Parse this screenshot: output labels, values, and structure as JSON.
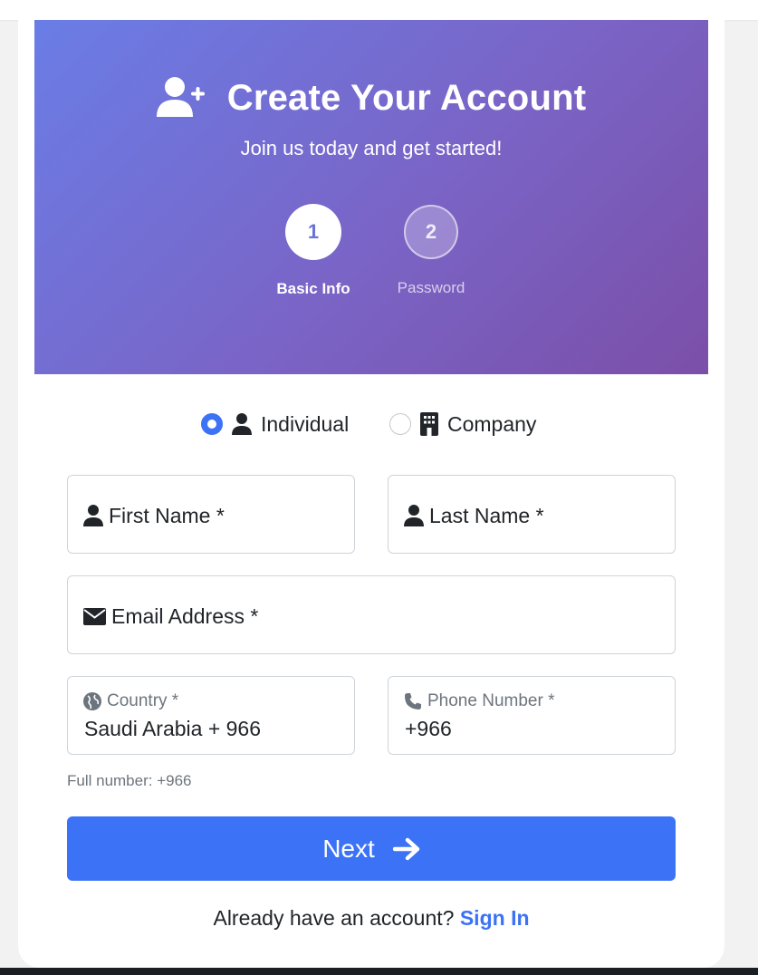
{
  "header": {
    "title": "Create Your Account",
    "subtitle": "Join us today and get started!",
    "icon": "user-plus-icon"
  },
  "steps": [
    {
      "number": "1",
      "label": "Basic Info",
      "state": "active"
    },
    {
      "number": "2",
      "label": "Password",
      "state": "inactive"
    }
  ],
  "account_type": {
    "options": [
      {
        "label": "Individual",
        "icon": "user-icon",
        "selected": true
      },
      {
        "label": "Company",
        "icon": "building-icon",
        "selected": false
      }
    ]
  },
  "form": {
    "first_name": {
      "label": "First Name *",
      "icon": "user-icon"
    },
    "last_name": {
      "label": "Last Name *",
      "icon": "user-icon"
    },
    "email": {
      "label": "Email Address *",
      "icon": "envelope-icon"
    },
    "country": {
      "label": "Country *",
      "value": "Saudi Arabia + 966",
      "icon": "globe-icon"
    },
    "phone": {
      "label": "Phone Number *",
      "value": "+966",
      "icon": "phone-icon"
    },
    "hint": "Full number: +966"
  },
  "next_button": {
    "label": "Next",
    "icon": "arrow-right-icon"
  },
  "signin": {
    "prompt": "Already have an account?",
    "link": "Sign In"
  },
  "colors": {
    "accent": "#3b72f6",
    "gradient_start": "#6a7de6",
    "gradient_end": "#7b4fa8"
  }
}
